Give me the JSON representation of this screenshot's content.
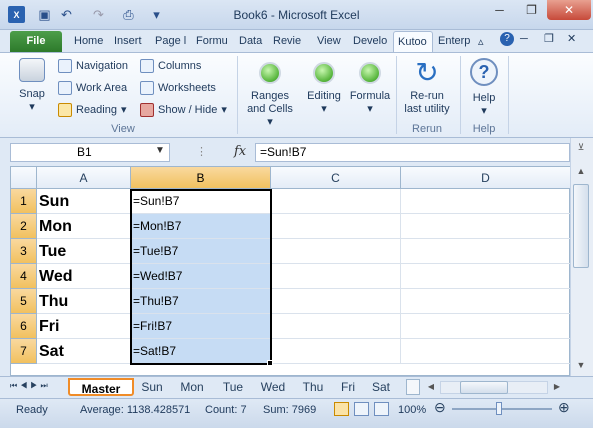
{
  "window": {
    "title": "Book6  -  Microsoft Excel",
    "minimize": "─",
    "restore": "❐",
    "close": "✕"
  },
  "ribbon_tabs": [
    "File",
    "Home",
    "Insert",
    "Page l",
    "Formu",
    "Data",
    "Revie",
    "View",
    "Develo",
    "Kutoo",
    "Enterp"
  ],
  "ribbon": {
    "snap": "Snap",
    "navigation": "Navigation",
    "work_area": "Work Area",
    "reading": "Reading",
    "columns": "Columns",
    "worksheets": "Worksheets",
    "show_hide": "Show / Hide",
    "group_view": "View",
    "ranges_cells_1": "Ranges",
    "ranges_cells_2": "and Cells",
    "editing": "Editing",
    "formula": "Formula",
    "rerun_1": "Re-run",
    "rerun_2": "last utility",
    "group_rerun": "Rerun",
    "help": "Help",
    "group_help": "Help"
  },
  "formula_bar": {
    "name_box": "B1",
    "fx": "fx",
    "formula": "=Sun!B7"
  },
  "grid": {
    "columns": [
      "A",
      "B",
      "C",
      "D"
    ],
    "rows": [
      {
        "n": "1",
        "a": "Sun",
        "b": "=Sun!B7"
      },
      {
        "n": "2",
        "a": "Mon",
        "b": "=Mon!B7"
      },
      {
        "n": "3",
        "a": "Tue",
        "b": "=Tue!B7"
      },
      {
        "n": "4",
        "a": "Wed",
        "b": "=Wed!B7"
      },
      {
        "n": "5",
        "a": "Thu",
        "b": "=Thu!B7"
      },
      {
        "n": "6",
        "a": "Fri",
        "b": "=Fri!B7"
      },
      {
        "n": "7",
        "a": "Sat",
        "b": "=Sat!B7"
      }
    ]
  },
  "sheets": [
    "Master",
    "Sun",
    "Mon",
    "Tue",
    "Wed",
    "Thu",
    "Fri",
    "Sat"
  ],
  "status": {
    "ready": "Ready",
    "average": "Average: 1138.428571",
    "count": "Count: 7",
    "sum": "Sum: 7969",
    "zoom": "100%"
  },
  "colors": {
    "accent_file": "#2d7a2b",
    "selection": "#c6dcf4",
    "sheet_highlight": "#f08c28"
  }
}
